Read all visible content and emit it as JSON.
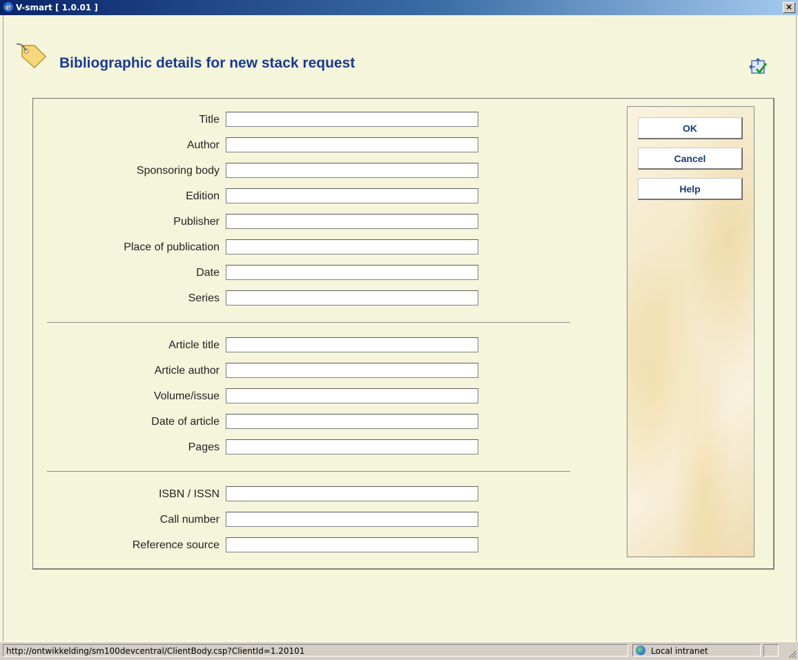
{
  "window": {
    "title": "V-smart [ 1.0.01 ]",
    "close_label": "×"
  },
  "header": {
    "title": "Bibliographic details for new stack request",
    "tag_icon": "tag-icon",
    "save_icon": "save-checkmark-icon"
  },
  "form": {
    "group1": [
      {
        "label": "Title",
        "value": ""
      },
      {
        "label": "Author",
        "value": ""
      },
      {
        "label": "Sponsoring body",
        "value": ""
      },
      {
        "label": "Edition",
        "value": ""
      },
      {
        "label": "Publisher",
        "value": ""
      },
      {
        "label": "Place of publication",
        "value": ""
      },
      {
        "label": "Date",
        "value": ""
      },
      {
        "label": "Series",
        "value": ""
      }
    ],
    "group2": [
      {
        "label": "Article title",
        "value": ""
      },
      {
        "label": "Article author",
        "value": ""
      },
      {
        "label": "Volume/issue",
        "value": ""
      },
      {
        "label": "Date of article",
        "value": ""
      },
      {
        "label": "Pages",
        "value": ""
      }
    ],
    "group3": [
      {
        "label": "ISBN / ISSN",
        "value": ""
      },
      {
        "label": "Call number",
        "value": ""
      },
      {
        "label": "Reference source",
        "value": ""
      }
    ]
  },
  "buttons": {
    "ok": "OK",
    "cancel": "Cancel",
    "help": "Help"
  },
  "statusbar": {
    "url": "http://ontwikkelding/sm100devcentral/ClientBody.csp?ClientId=1.20101",
    "zone": "Local intranet"
  }
}
